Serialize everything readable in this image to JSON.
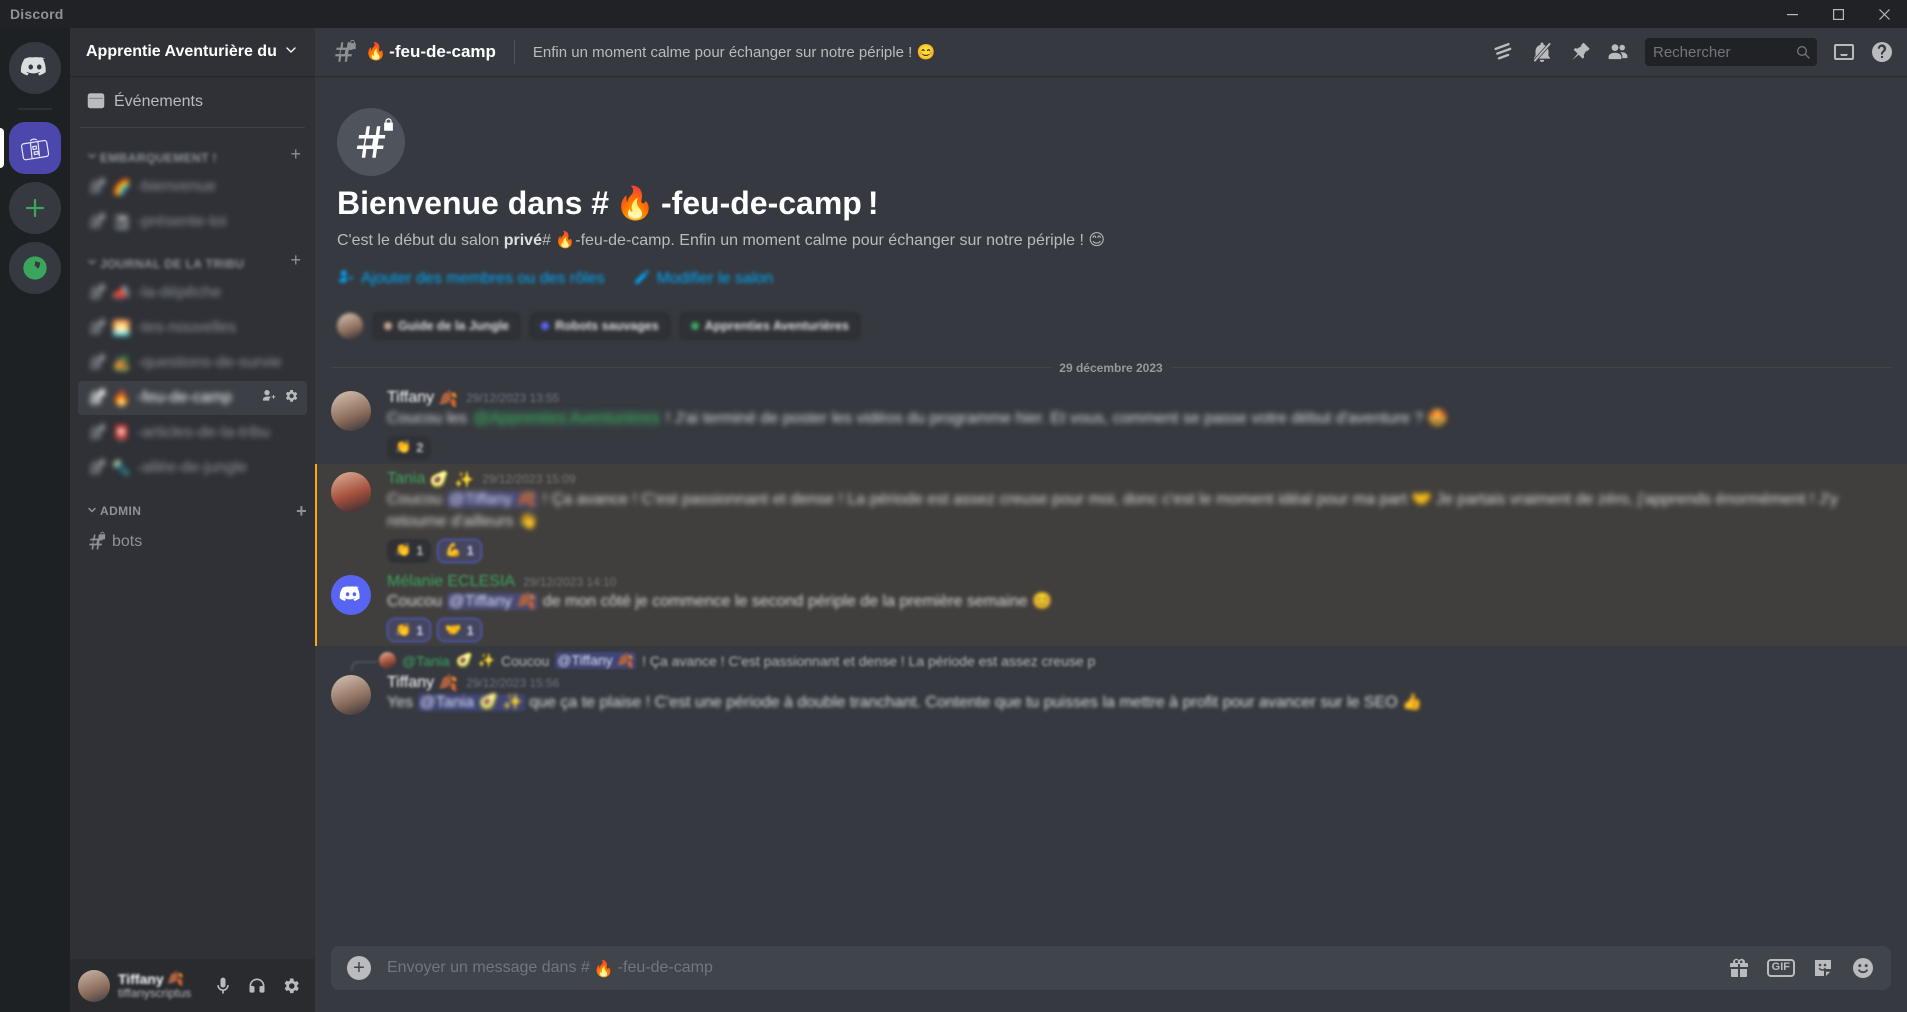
{
  "window": {
    "title": "Discord",
    "minimize": "—",
    "maximize": "□",
    "close": "✕"
  },
  "guild_rail": {
    "home_label": "Accueil Discord",
    "server_label": "Apprentie Aventurière du Sud",
    "add_label": "Ajouter un serveur",
    "explore_label": "Découvrir des serveurs"
  },
  "sidebar": {
    "server_name": "Apprentie Aventurière du S",
    "nav": [
      {
        "label": "Événements",
        "icon": "calendar-icon"
      }
    ],
    "categories": [
      {
        "label": "EMBARQUEMENT !",
        "blurred": true,
        "channels": [
          {
            "emoji": "🌈",
            "name": "-bienvenue",
            "locked": true,
            "blurred": true,
            "active": false
          },
          {
            "emoji": "📓",
            "name": "-présente-toi",
            "locked": true,
            "blurred": true,
            "active": false
          }
        ]
      },
      {
        "label": "JOURNAL DE LA TRIBU",
        "blurred": true,
        "channels": [
          {
            "emoji": "📣",
            "name": "-la-dépêche",
            "locked": true,
            "blurred": true,
            "active": false
          },
          {
            "emoji": "🌅",
            "name": "-tes-nouvelles",
            "locked": true,
            "blurred": true,
            "active": false
          },
          {
            "emoji": "🏕️",
            "name": "-questions-de-survie",
            "locked": true,
            "blurred": true,
            "active": false
          },
          {
            "emoji": "🔥",
            "name": "-feu-de-camp",
            "locked": true,
            "blurred": true,
            "active": true
          },
          {
            "emoji": "📮",
            "name": "-articles-de-la-tribu",
            "locked": true,
            "blurred": true,
            "active": false
          },
          {
            "emoji": "🔦",
            "name": "-allée-de-jungle",
            "locked": true,
            "blurred": true,
            "active": false
          }
        ]
      },
      {
        "label": "ADMIN",
        "blurred": false,
        "channels": [
          {
            "emoji": "",
            "name": "bots",
            "locked": true,
            "blurred": false,
            "active": false
          }
        ]
      }
    ],
    "add_channel_label": "+"
  },
  "user_panel": {
    "name": "Tiffany",
    "name_emoji": "🍂",
    "tag": "tiffanyscriptus",
    "buttons": [
      {
        "name": "mute-button",
        "icon": "microphone-icon"
      },
      {
        "name": "deafen-button",
        "icon": "headphones-icon"
      },
      {
        "name": "settings-button",
        "icon": "gear-icon"
      }
    ]
  },
  "channel_header": {
    "emoji": "🔥",
    "name": "-feu-de-camp",
    "topic": "Enfin un moment calme pour échanger sur notre périple ! 😊",
    "icons": [
      {
        "name": "threads-icon",
        "title": "Fils de discussion"
      },
      {
        "name": "bell-off-icon",
        "title": "Notifications désactivées"
      },
      {
        "name": "pin-icon",
        "title": "Messages épinglés"
      },
      {
        "name": "members-icon",
        "title": "Liste des membres"
      }
    ],
    "search_placeholder": "Rechercher",
    "inbox_title": "Boîte de réception",
    "help_title": "Aide"
  },
  "welcome": {
    "title_prefix": "Bienvenue dans #",
    "emoji": "🔥",
    "title_channel": "-feu-de-camp",
    "title_suffix": "!",
    "sub_pre": "C'est le début du salon ",
    "sub_bold": "privé",
    "sub_hash": "#",
    "sub_channel": "-feu-de-camp.",
    "sub_post": "Enfin un moment calme pour échanger sur notre périple !",
    "sub_emoji": "😊",
    "links": [
      {
        "label": "Ajouter des membres ou des rôles",
        "icon": "add-member-icon"
      },
      {
        "label": "Modifier le salon",
        "icon": "pencil-icon"
      }
    ],
    "roles": [
      {
        "label": "Guide de la Jungle",
        "color": "#c9a48a"
      },
      {
        "label": "Robots sauvages",
        "color": "#5865f2"
      },
      {
        "label": "Apprenties Aventurières",
        "color": "#3ba55d"
      }
    ]
  },
  "date_divider": "29 décembre 2023",
  "messages": [
    {
      "author": "Tiffany",
      "author_emoji": "🍂",
      "author_color": "#ffffff",
      "timestamp": "29/12/2023 13:55",
      "mention_highlight": false,
      "blurred": true,
      "avatar": "tiffany",
      "text_pre": "Coucou les ",
      "mention": "@Apprenties Aventurières",
      "mention_kind": "role",
      "text_post": " ! J'ai terminé de poster les vidéos du programme hier. Et vous, comment se passe votre début d'aventure ? 🤩",
      "reactions": [
        {
          "emoji": "👏",
          "count": "2",
          "me": false
        }
      ]
    },
    {
      "author": "Tania",
      "author_emoji": "🥑 ✨",
      "author_color": "#3ba55d",
      "timestamp": "29/12/2023 15:09",
      "mention_highlight": true,
      "blurred": true,
      "avatar": "tania",
      "text_pre": "Coucou ",
      "mention": "@Tiffany 🍂",
      "mention_kind": "user",
      "text_post": " ! Ça avance ! C'est passionnant et dense ! La période est assez creuse pour moi, donc c'est le moment idéal pour ma part 🤝 Je partais vraiment de zéro, j'apprends énormément ! J'y retourne d'ailleurs 👋",
      "reactions": [
        {
          "emoji": "👏",
          "count": "1",
          "me": false
        },
        {
          "emoji": "💪",
          "count": "1",
          "me": true
        }
      ]
    },
    {
      "author": "Mélanie ECLESIA",
      "author_emoji": "",
      "author_color": "#3ba55d",
      "timestamp": "29/12/2023 14:10",
      "mention_highlight": true,
      "blurred": true,
      "avatar": "bot",
      "text_pre": "Coucou ",
      "mention": "@Tiffany 🍂",
      "mention_kind": "user",
      "text_post": " de mon côté je commence le second périple de la première semaine 😊",
      "reactions": [
        {
          "emoji": "👏",
          "count": "1",
          "me": true
        },
        {
          "emoji": "🤝",
          "count": "1",
          "me": true
        }
      ]
    }
  ],
  "last_message": {
    "reply_author": "@Tania",
    "reply_emoji": "🥑 ✨",
    "reply_pre": "Coucou ",
    "reply_mention": "@Tiffany 🍂",
    "reply_post": " ! Ça avance ! C'est passionnant et dense ! La période est assez creuse p",
    "author": "Tiffany",
    "author_emoji": "🍂",
    "timestamp": "29/12/2023 15:56",
    "text_pre": "Yes ",
    "mention": "@Tania 🥑 ✨",
    "text_post": " que ça te plaise ! C'est une période à double tranchant. Contente que tu puisses la mettre à profit pour avancer sur le SEO 👍"
  },
  "composer": {
    "placeholder_pre": "Envoyer un message dans #",
    "placeholder_emoji": "🔥",
    "placeholder_channel": "-feu-de-camp",
    "plus_label": "+",
    "icons": [
      {
        "name": "gift-icon",
        "label": ""
      },
      {
        "name": "gif-icon",
        "label": "GIF"
      },
      {
        "name": "sticker-icon",
        "label": ""
      },
      {
        "name": "emoji-icon",
        "label": ""
      }
    ]
  }
}
